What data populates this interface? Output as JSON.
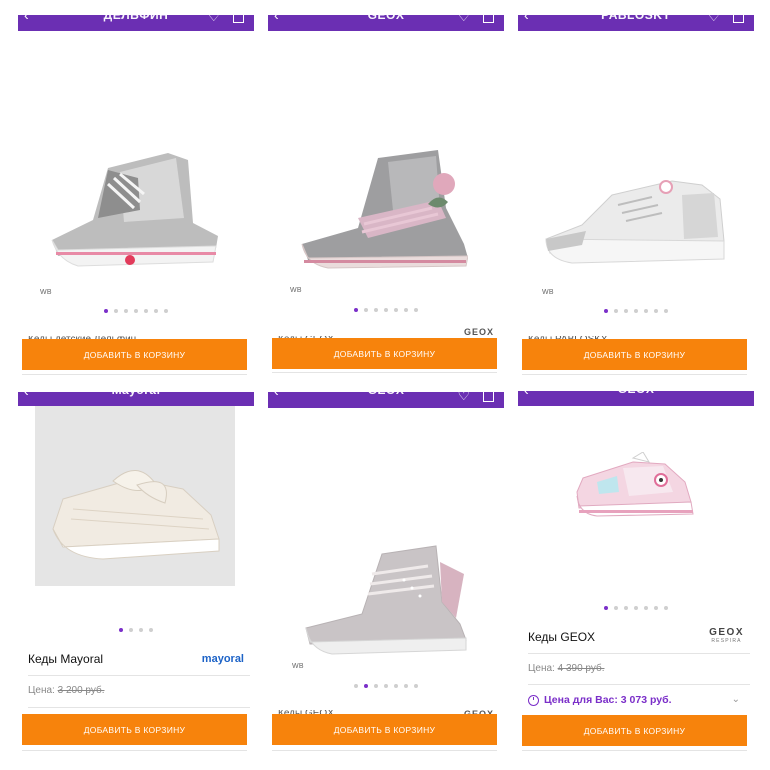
{
  "colors": {
    "accent": "#6b2fb3",
    "button": "#f7830c",
    "dot_active": "#7b2fc9"
  },
  "cards": [
    {
      "bar_title": "ДЕЛЬФИН",
      "dots_total": 7,
      "dots_active": 0,
      "cut_name": "Кеды детские Дельфин",
      "wb": "WB",
      "button": "ДОБАВИТЬ В КОРЗИНУ"
    },
    {
      "bar_title": "GEOX",
      "dots_total": 7,
      "dots_active": 0,
      "cut_name": "Кеды GEOX",
      "brand": "GEOX",
      "wb": "WB",
      "button": "ДОБАВИТЬ В КОРЗИНУ"
    },
    {
      "bar_title": "PABLOSKY",
      "dots_total": 7,
      "dots_active": 0,
      "cut_name": "Кеды PABLOSKY",
      "wb": "WB",
      "button": "ДОБАВИТЬ В КОРЗИНУ"
    },
    {
      "bar_title": "Mayoral",
      "dots_total": 4,
      "dots_active": 0,
      "name": "Кеды Mayoral",
      "brand": "mayoral",
      "price_label": "Цена:",
      "old_price": "3 200 руб.",
      "button": "ДОБАВИТЬ В КОРЗИНУ"
    },
    {
      "bar_title": "GEOX",
      "dots_total": 7,
      "dots_active": 1,
      "cut_name": "Кеды GEOX",
      "brand": "GEOX",
      "wb": "WB",
      "button": "ДОБАВИТЬ В КОРЗИНУ"
    },
    {
      "bar_title": "GEOX",
      "dots_total": 7,
      "dots_active": 0,
      "name": "Кеды GEOX",
      "brand": "GEOX",
      "brand_sub": "RESPIRA",
      "price_label": "Цена:",
      "old_price": "4 390 руб.",
      "your_price": "Цена для Вас: 3 073 руб.",
      "button": "ДОБАВИТЬ В КОРЗИНУ"
    }
  ]
}
